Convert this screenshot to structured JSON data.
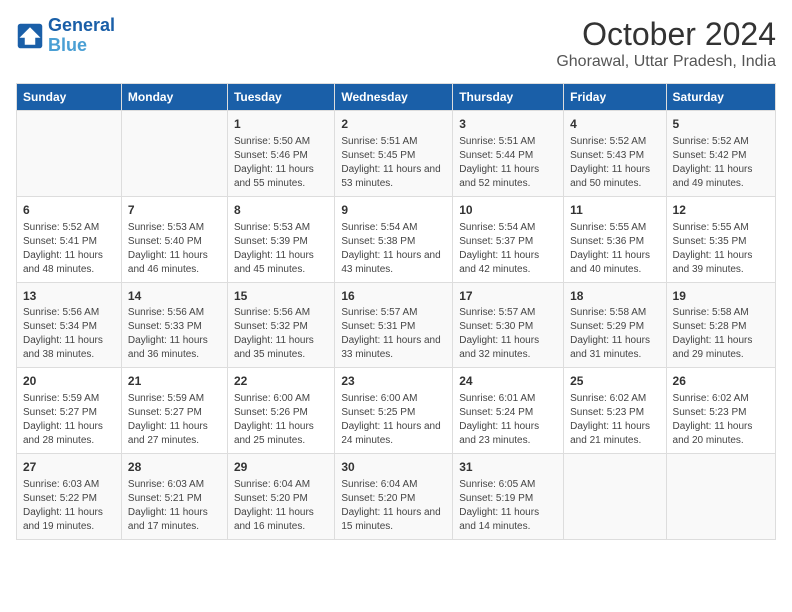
{
  "logo": {
    "general": "General",
    "blue": "Blue"
  },
  "header": {
    "title": "October 2024",
    "subtitle": "Ghorawal, Uttar Pradesh, India"
  },
  "columns": [
    "Sunday",
    "Monday",
    "Tuesday",
    "Wednesday",
    "Thursday",
    "Friday",
    "Saturday"
  ],
  "weeks": [
    [
      {
        "day": "",
        "info": ""
      },
      {
        "day": "",
        "info": ""
      },
      {
        "day": "1",
        "info": "Sunrise: 5:50 AM\nSunset: 5:46 PM\nDaylight: 11 hours and 55 minutes."
      },
      {
        "day": "2",
        "info": "Sunrise: 5:51 AM\nSunset: 5:45 PM\nDaylight: 11 hours and 53 minutes."
      },
      {
        "day": "3",
        "info": "Sunrise: 5:51 AM\nSunset: 5:44 PM\nDaylight: 11 hours and 52 minutes."
      },
      {
        "day": "4",
        "info": "Sunrise: 5:52 AM\nSunset: 5:43 PM\nDaylight: 11 hours and 50 minutes."
      },
      {
        "day": "5",
        "info": "Sunrise: 5:52 AM\nSunset: 5:42 PM\nDaylight: 11 hours and 49 minutes."
      }
    ],
    [
      {
        "day": "6",
        "info": "Sunrise: 5:52 AM\nSunset: 5:41 PM\nDaylight: 11 hours and 48 minutes."
      },
      {
        "day": "7",
        "info": "Sunrise: 5:53 AM\nSunset: 5:40 PM\nDaylight: 11 hours and 46 minutes."
      },
      {
        "day": "8",
        "info": "Sunrise: 5:53 AM\nSunset: 5:39 PM\nDaylight: 11 hours and 45 minutes."
      },
      {
        "day": "9",
        "info": "Sunrise: 5:54 AM\nSunset: 5:38 PM\nDaylight: 11 hours and 43 minutes."
      },
      {
        "day": "10",
        "info": "Sunrise: 5:54 AM\nSunset: 5:37 PM\nDaylight: 11 hours and 42 minutes."
      },
      {
        "day": "11",
        "info": "Sunrise: 5:55 AM\nSunset: 5:36 PM\nDaylight: 11 hours and 40 minutes."
      },
      {
        "day": "12",
        "info": "Sunrise: 5:55 AM\nSunset: 5:35 PM\nDaylight: 11 hours and 39 minutes."
      }
    ],
    [
      {
        "day": "13",
        "info": "Sunrise: 5:56 AM\nSunset: 5:34 PM\nDaylight: 11 hours and 38 minutes."
      },
      {
        "day": "14",
        "info": "Sunrise: 5:56 AM\nSunset: 5:33 PM\nDaylight: 11 hours and 36 minutes."
      },
      {
        "day": "15",
        "info": "Sunrise: 5:56 AM\nSunset: 5:32 PM\nDaylight: 11 hours and 35 minutes."
      },
      {
        "day": "16",
        "info": "Sunrise: 5:57 AM\nSunset: 5:31 PM\nDaylight: 11 hours and 33 minutes."
      },
      {
        "day": "17",
        "info": "Sunrise: 5:57 AM\nSunset: 5:30 PM\nDaylight: 11 hours and 32 minutes."
      },
      {
        "day": "18",
        "info": "Sunrise: 5:58 AM\nSunset: 5:29 PM\nDaylight: 11 hours and 31 minutes."
      },
      {
        "day": "19",
        "info": "Sunrise: 5:58 AM\nSunset: 5:28 PM\nDaylight: 11 hours and 29 minutes."
      }
    ],
    [
      {
        "day": "20",
        "info": "Sunrise: 5:59 AM\nSunset: 5:27 PM\nDaylight: 11 hours and 28 minutes."
      },
      {
        "day": "21",
        "info": "Sunrise: 5:59 AM\nSunset: 5:27 PM\nDaylight: 11 hours and 27 minutes."
      },
      {
        "day": "22",
        "info": "Sunrise: 6:00 AM\nSunset: 5:26 PM\nDaylight: 11 hours and 25 minutes."
      },
      {
        "day": "23",
        "info": "Sunrise: 6:00 AM\nSunset: 5:25 PM\nDaylight: 11 hours and 24 minutes."
      },
      {
        "day": "24",
        "info": "Sunrise: 6:01 AM\nSunset: 5:24 PM\nDaylight: 11 hours and 23 minutes."
      },
      {
        "day": "25",
        "info": "Sunrise: 6:02 AM\nSunset: 5:23 PM\nDaylight: 11 hours and 21 minutes."
      },
      {
        "day": "26",
        "info": "Sunrise: 6:02 AM\nSunset: 5:23 PM\nDaylight: 11 hours and 20 minutes."
      }
    ],
    [
      {
        "day": "27",
        "info": "Sunrise: 6:03 AM\nSunset: 5:22 PM\nDaylight: 11 hours and 19 minutes."
      },
      {
        "day": "28",
        "info": "Sunrise: 6:03 AM\nSunset: 5:21 PM\nDaylight: 11 hours and 17 minutes."
      },
      {
        "day": "29",
        "info": "Sunrise: 6:04 AM\nSunset: 5:20 PM\nDaylight: 11 hours and 16 minutes."
      },
      {
        "day": "30",
        "info": "Sunrise: 6:04 AM\nSunset: 5:20 PM\nDaylight: 11 hours and 15 minutes."
      },
      {
        "day": "31",
        "info": "Sunrise: 6:05 AM\nSunset: 5:19 PM\nDaylight: 11 hours and 14 minutes."
      },
      {
        "day": "",
        "info": ""
      },
      {
        "day": "",
        "info": ""
      }
    ]
  ]
}
